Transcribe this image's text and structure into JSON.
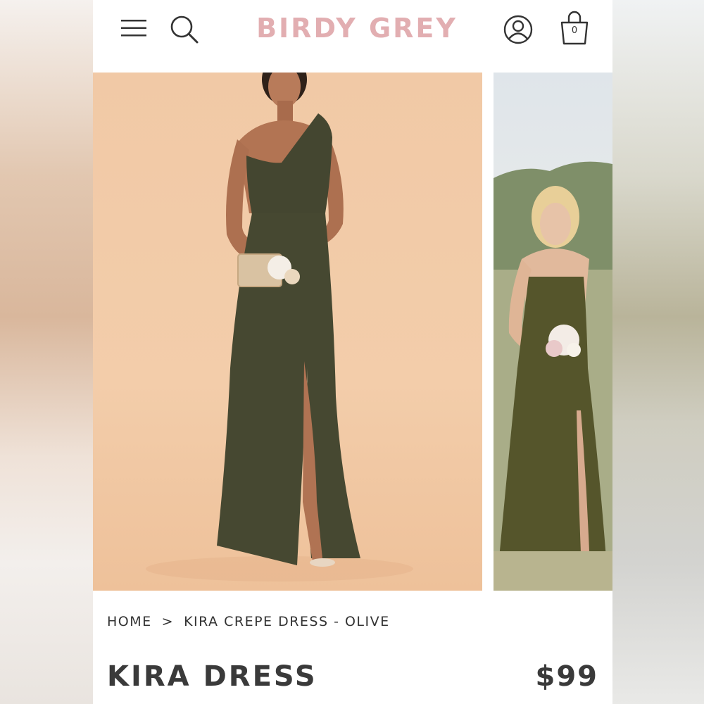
{
  "header": {
    "logo": "BIRDY GREY",
    "cart_count": "0",
    "icons": [
      "menu-icon",
      "search-icon",
      "account-icon",
      "shopping-bag-icon"
    ],
    "logo_color": "#e2aeb1"
  },
  "gallery": {
    "main_image": "model in olive one-shoulder dress holding clutch and flowers",
    "thumbnail_image": "bridesmaids in olive dresses holding bouquet outdoors"
  },
  "breadcrumb": {
    "home": "HOME",
    "separator": ">",
    "current": "KIRA CREPE DRESS - OLIVE"
  },
  "product": {
    "title": "KIRA DRESS",
    "price": "$99",
    "dress_color": "#4a4a36"
  }
}
